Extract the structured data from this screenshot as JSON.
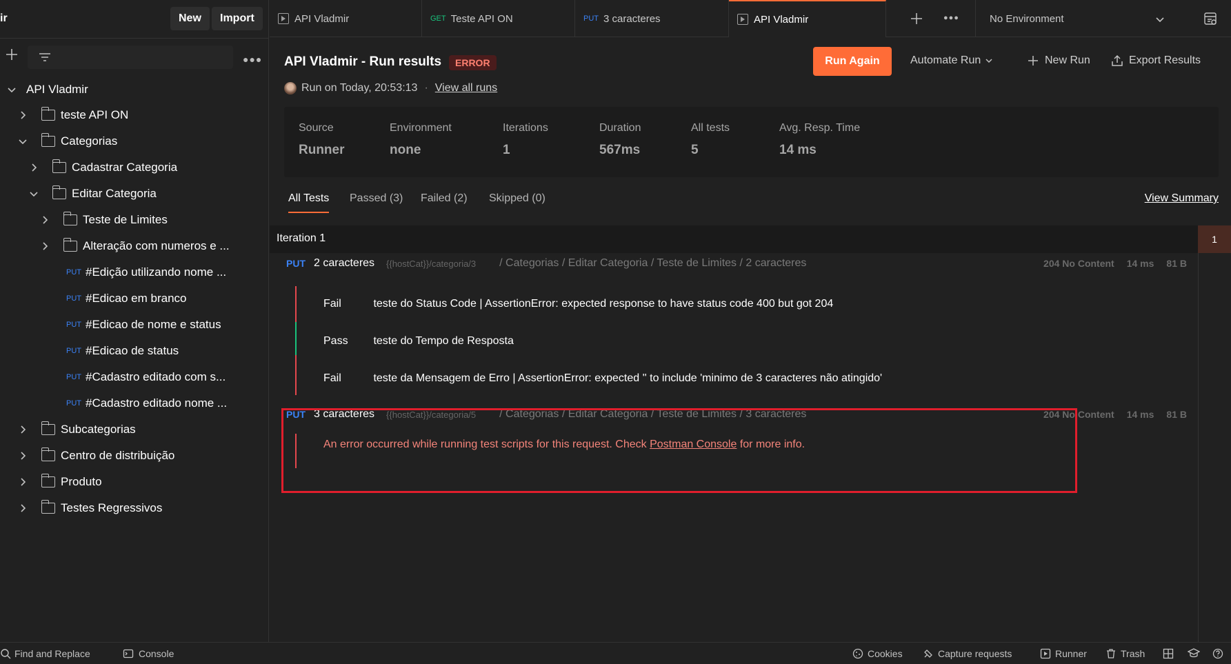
{
  "sidebar": {
    "workspace_fragment": "ir",
    "new_label": "New",
    "import_label": "Import",
    "collection": "API Vladmir",
    "items": [
      {
        "label": "teste API ON",
        "type": "folder"
      },
      {
        "label": "Categorias",
        "type": "folder"
      },
      {
        "label": "Cadastrar Categoria",
        "type": "folder"
      },
      {
        "label": "Editar Categoria",
        "type": "folder"
      },
      {
        "label": "Teste de Limites",
        "type": "folder"
      },
      {
        "label": "Alteração com numeros e ...",
        "type": "folder"
      },
      {
        "label": "#Edição utilizando nome ...",
        "type": "request",
        "method": "PUT"
      },
      {
        "label": "#Edicao em branco",
        "type": "request",
        "method": "PUT"
      },
      {
        "label": "#Edicao de nome e status",
        "type": "request",
        "method": "PUT"
      },
      {
        "label": "#Edicao de status",
        "type": "request",
        "method": "PUT"
      },
      {
        "label": "#Cadastro editado com s...",
        "type": "request",
        "method": "PUT"
      },
      {
        "label": "#Cadastro editado nome ...",
        "type": "request",
        "method": "PUT"
      },
      {
        "label": "Subcategorias",
        "type": "folder"
      },
      {
        "label": "Centro de distribuição",
        "type": "folder"
      },
      {
        "label": "Produto",
        "type": "folder"
      },
      {
        "label": "Testes Regressivos",
        "type": "folder"
      }
    ]
  },
  "tabs": [
    {
      "label": "API Vladmir",
      "method": ""
    },
    {
      "label": "Teste API ON",
      "method": "GET"
    },
    {
      "label": "3 caracteres",
      "method": "PUT"
    },
    {
      "label": "API Vladmir",
      "method": ""
    }
  ],
  "environment": "No Environment",
  "run": {
    "title": "API Vladmir - Run results",
    "badge": "ERROR",
    "meta": "Run on Today, 20:53:13",
    "separator": "·",
    "view_all": "View all runs",
    "run_again": "Run Again",
    "automate": "Automate Run",
    "new_run": "New Run",
    "export": "Export Results"
  },
  "summary": {
    "source_label": "Source",
    "source_value": "Runner",
    "env_label": "Environment",
    "env_value": "none",
    "iter_label": "Iterations",
    "iter_value": "1",
    "dur_label": "Duration",
    "dur_value": "567ms",
    "tests_label": "All tests",
    "tests_value": "5",
    "avg_label": "Avg. Resp. Time",
    "avg_value": "14 ms"
  },
  "filter_tabs": {
    "all": "All Tests",
    "passed": "Passed (3)",
    "failed": "Failed (2)",
    "skipped": "Skipped (0)",
    "view_summary": "View Summary"
  },
  "iteration": {
    "label": "Iteration 1",
    "number": "1"
  },
  "requests": [
    {
      "method": "PUT",
      "name": "2 caracteres",
      "url": "{{hostCat}}/categoria/3",
      "path": "/ Categorias / Editar Categoria / Teste de Limites / 2 caracteres",
      "status": "204 No Content",
      "time": "14 ms",
      "size": "81 B",
      "results": [
        {
          "status": "Fail",
          "text": "teste do Status Code | AssertionError: expected response to have status code 400 but got 204"
        },
        {
          "status": "Pass",
          "text": "teste do Tempo de Resposta"
        },
        {
          "status": "Fail",
          "text": "teste da Mensagem de Erro | AssertionError: expected '' to include 'minimo de 3 caracteres não atingido'"
        }
      ]
    },
    {
      "method": "PUT",
      "name": "3 caracteres",
      "url": "{{hostCat}}/categoria/5",
      "path": "/ Categorias / Editar Categoria / Teste de Limites / 3 caracteres",
      "status": "204 No Content",
      "time": "14 ms",
      "size": "81 B",
      "error_pre": "An error occurred while running test scripts for this request. Check ",
      "error_link": "Postman Console",
      "error_post": " for more info."
    }
  ],
  "statusbar": {
    "find_replace": "Find and Replace",
    "console": "Console",
    "cookies": "Cookies",
    "capture": "Capture requests",
    "runner": "Runner",
    "trash": "Trash"
  },
  "colors": {
    "accent": "#ff6c37",
    "fail": "#e5484d",
    "pass": "#19c37d",
    "put": "#3b82f6",
    "get": "#19c37d",
    "highlight": "#e01e2c"
  }
}
